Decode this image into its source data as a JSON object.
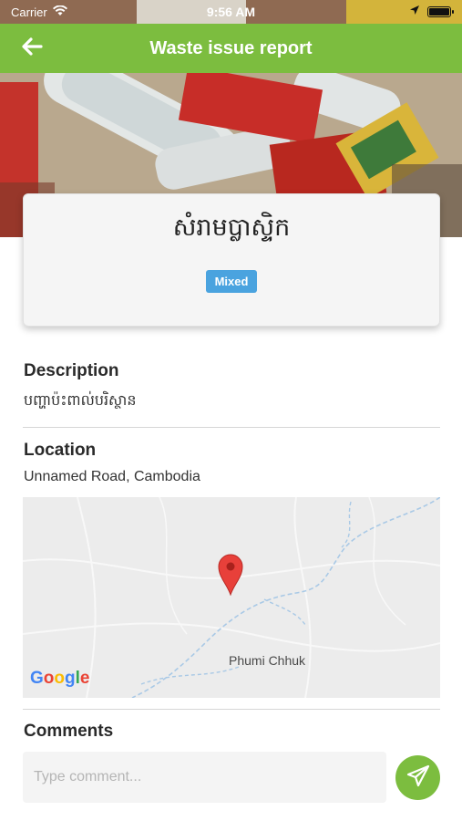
{
  "status_bar": {
    "carrier": "Carrier",
    "time": "9:56 AM",
    "battery_level": 1.0
  },
  "app_bar": {
    "title": "Waste issue report",
    "back_icon": "arrow-left-icon"
  },
  "report": {
    "waste_type": "សំរាមប្លាស្ទិក",
    "category_badge": "Mixed"
  },
  "description": {
    "label": "Description",
    "value": "បញ្ហាប៉ះពាល់បរិស្ថាន"
  },
  "location": {
    "label": "Location",
    "address": "Unnamed Road, Cambodia",
    "map": {
      "place_label": "Phumi Chhuk",
      "provider_logo": "Google",
      "pin_icon": "map-pin-icon"
    }
  },
  "comments": {
    "label": "Comments",
    "placeholder": "Type comment...",
    "send_icon": "send-icon"
  },
  "colors": {
    "accent": "#7cbd3f",
    "badge": "#4aa3df",
    "pin": "#e8403a"
  }
}
